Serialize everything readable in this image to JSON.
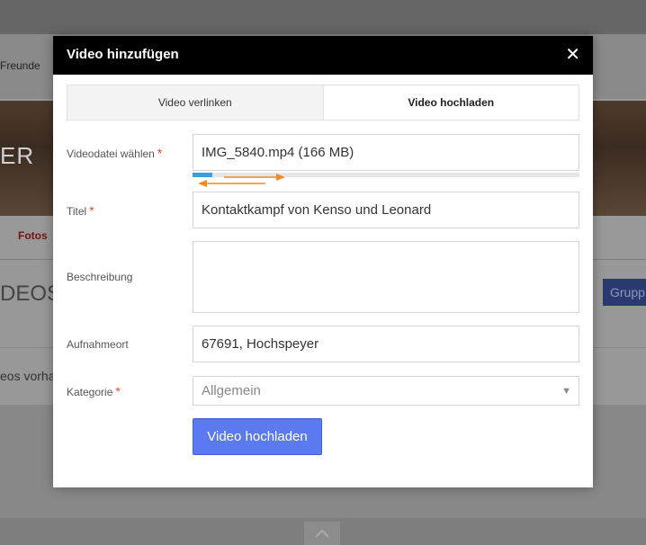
{
  "background": {
    "nav_link": "Freunde",
    "banner_text": "ER",
    "tab_photos": "Fotos",
    "heading": "DEOS",
    "group_button": "Grupp",
    "no_videos_text": "eos vorha",
    "scroll_top_icon": "chevron-up-icon"
  },
  "modal": {
    "title": "Video hinzufügen",
    "close_icon": "close-icon",
    "tabs": [
      {
        "label": "Video verlinken",
        "active": false
      },
      {
        "label": "Video hochladen",
        "active": true
      }
    ],
    "file": {
      "label": "Videodatei wählen",
      "required": "*",
      "value": "IMG_5840.mp4 (166 MB)",
      "progress_percent": 5
    },
    "title_field": {
      "label": "Titel",
      "required": "*",
      "value": "Kontaktkampf von Kenso und Leonard"
    },
    "description": {
      "label": "Beschreibung",
      "value": ""
    },
    "location": {
      "label": "Aufnahmeort",
      "value": "67691, Hochspeyer"
    },
    "category": {
      "label": "Kategorie",
      "required": "*",
      "value": "Allgemein"
    },
    "submit_label": "Video hochladen"
  },
  "colors": {
    "header_bg": "#000000",
    "primary_button": "#5b7af0",
    "progress": "#3aa0dd",
    "required": "#e04b2f",
    "annotation_arrow": "#f08a24"
  }
}
